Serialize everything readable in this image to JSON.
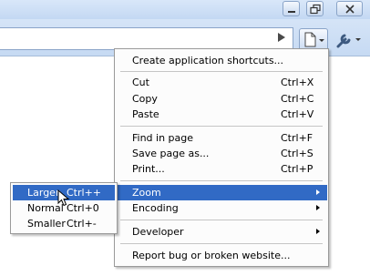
{
  "menu": {
    "items": [
      {
        "label": "Create application shortcuts...",
        "shortcut": ""
      },
      {
        "label": "Cut",
        "shortcut": "Ctrl+X"
      },
      {
        "label": "Copy",
        "shortcut": "Ctrl+C"
      },
      {
        "label": "Paste",
        "shortcut": "Ctrl+V"
      },
      {
        "label": "Find in page",
        "shortcut": "Ctrl+F"
      },
      {
        "label": "Save page as...",
        "shortcut": "Ctrl+S"
      },
      {
        "label": "Print...",
        "shortcut": "Ctrl+P"
      },
      {
        "label": "Zoom",
        "shortcut": ""
      },
      {
        "label": "Encoding",
        "shortcut": ""
      },
      {
        "label": "Developer",
        "shortcut": ""
      },
      {
        "label": "Report bug or broken website...",
        "shortcut": ""
      }
    ]
  },
  "zoom_submenu": {
    "items": [
      {
        "label": "Larger",
        "shortcut": "Ctrl++"
      },
      {
        "label": "Normal",
        "shortcut": "Ctrl+0"
      },
      {
        "label": "Smaller",
        "shortcut": "Ctrl+-"
      }
    ]
  },
  "colors": {
    "highlight": "#316ac5",
    "chrome": "#c6daf3"
  },
  "icons": {
    "window": [
      "minimize-icon",
      "maximize-icon",
      "close-icon"
    ],
    "toolbar": [
      "go-icon",
      "page-icon",
      "wrench-icon"
    ]
  }
}
